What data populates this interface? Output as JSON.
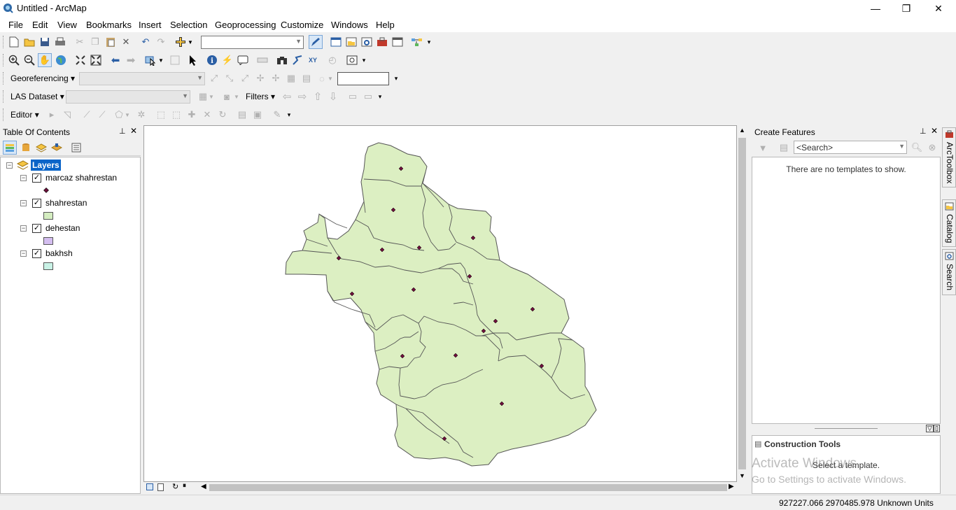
{
  "window": {
    "title": "Untitled - ArcMap",
    "minimize": "—",
    "restore": "❐",
    "close": "✕"
  },
  "menu": [
    "File",
    "Edit",
    "View",
    "Bookmarks",
    "Insert",
    "Selection",
    "Geoprocessing",
    "Customize",
    "Windows",
    "Help"
  ],
  "toolbars": {
    "georeferencing_label": "Georeferencing",
    "las_label": "LAS Dataset",
    "filters_label": "Filters",
    "editor_label": "Editor"
  },
  "toc": {
    "title": "Table Of Contents",
    "root": "Layers",
    "layers": [
      {
        "name": "marcaz shahrestan",
        "checked": true,
        "symbol": "point",
        "color": "#6b0f3a"
      },
      {
        "name": "shahrestan",
        "checked": true,
        "symbol": "polygon",
        "color": "#d4edc0"
      },
      {
        "name": "dehestan",
        "checked": true,
        "symbol": "polygon",
        "color": "#d4bef0"
      },
      {
        "name": "bakhsh",
        "checked": true,
        "symbol": "polygon",
        "color": "#c9f2e6"
      }
    ]
  },
  "map": {
    "fill_color": "#dcefc2",
    "point_color": "#6b0f3a"
  },
  "create_features": {
    "title": "Create Features",
    "search_placeholder": "<Search>",
    "empty_text": "There are no templates to show."
  },
  "construction_tools": {
    "title": "Construction Tools",
    "empty_text": "Select a template."
  },
  "watermark": {
    "line1": "Activate Windows",
    "line2": "Go to Settings to activate Windows."
  },
  "side_tabs": [
    "ArcToolbox",
    "Catalog",
    "Search"
  ],
  "status": {
    "coordinates": "927227.066  2970485.978 Unknown Units"
  }
}
